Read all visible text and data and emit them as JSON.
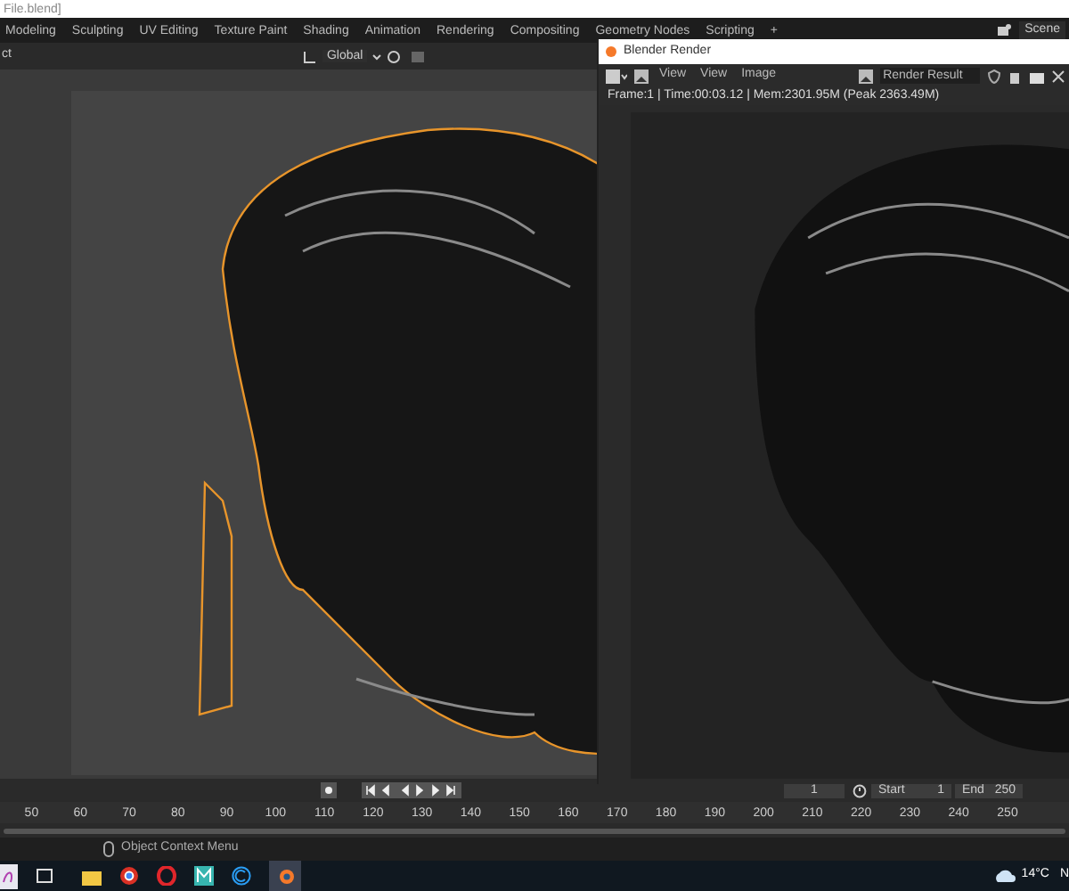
{
  "title_bar": {
    "title": "File.blend]"
  },
  "workspace_tabs": [
    "Modeling",
    "Sculpting",
    "UV Editing",
    "Texture Paint",
    "Shading",
    "Animation",
    "Rendering",
    "Compositing",
    "Geometry Nodes",
    "Scripting",
    "+"
  ],
  "scene": {
    "label": "Scene"
  },
  "viewport_header": {
    "mode_label": "ct",
    "orientation": "Global"
  },
  "render_window": {
    "title": "Blender Render",
    "menus": [
      "View",
      "View",
      "Image"
    ],
    "slot": "Render Result",
    "status": "Frame:1 | Time:00:03.12 | Mem:2301.95M (Peak 2363.49M)"
  },
  "timeline": {
    "current_frame": "1",
    "start_label": "Start",
    "start": "1",
    "end_label": "End",
    "end": "250",
    "ruler": [
      "50",
      "60",
      "70",
      "80",
      "90",
      "100",
      "110",
      "120",
      "130",
      "140",
      "150",
      "160",
      "170",
      "180",
      "190",
      "200",
      "210",
      "220",
      "230",
      "240",
      "250"
    ]
  },
  "status_bar": {
    "hint": "Object Context Menu"
  },
  "taskbar": {
    "temperature": "14°C",
    "clock_fragment": "N"
  }
}
